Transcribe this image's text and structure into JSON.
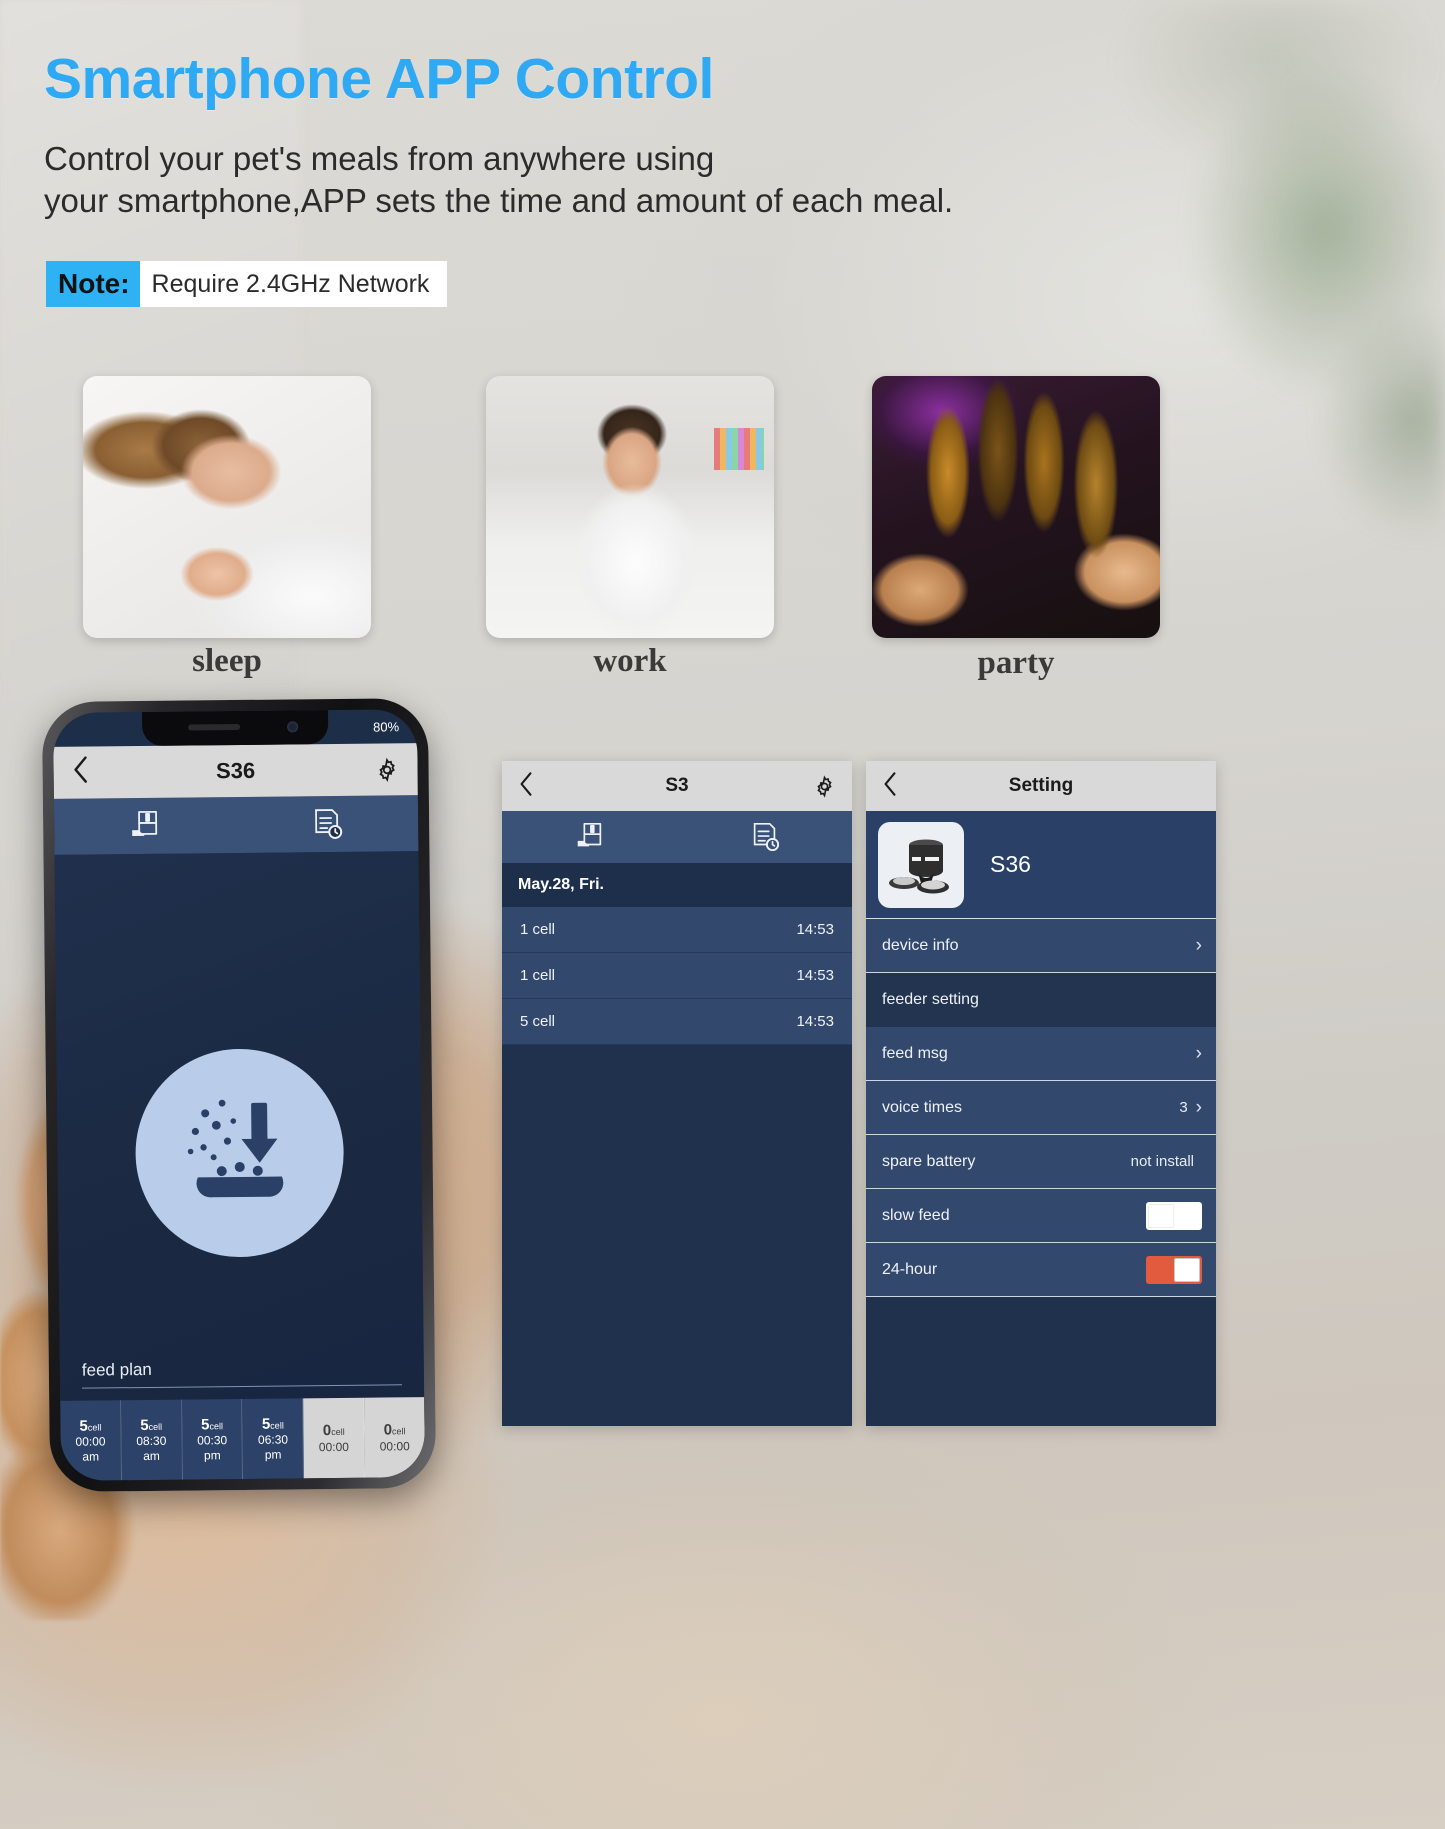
{
  "header": {
    "title": "Smartphone APP Control",
    "subtitle_line1": "Control your pet's meals from anywhere using",
    "subtitle_line2": "your smartphone,APP sets the time and amount of each meal.",
    "note_tag": "Note:",
    "note_text": "Require 2.4GHz Network",
    "accent_color": "#2fa9f4",
    "note_tag_color": "#2eb2f4"
  },
  "scenes": [
    {
      "caption": "sleep",
      "image_name": "woman-sleeping-photo"
    },
    {
      "caption": "work",
      "image_name": "woman-working-photo"
    },
    {
      "caption": "party",
      "image_name": "people-toasting-bottles-photo"
    }
  ],
  "phone": {
    "status": {
      "battery": "80%"
    },
    "navbar": {
      "back_icon": "chevron-left-icon",
      "title": "S36",
      "gear_icon": "gear-icon"
    },
    "tabs": [
      {
        "icon": "feeder-device-icon"
      },
      {
        "icon": "feed-log-clock-icon"
      }
    ],
    "main": {
      "center_icon": "food-dispense-icon"
    },
    "feed_plan_label": "feed plan",
    "schedule": [
      {
        "amount": "5",
        "unit": "cell",
        "time": "00:00",
        "meridiem": "am",
        "state": "active"
      },
      {
        "amount": "5",
        "unit": "cell",
        "time": "08:30",
        "meridiem": "am",
        "state": "active"
      },
      {
        "amount": "5",
        "unit": "cell",
        "time": "00:30",
        "meridiem": "pm",
        "state": "active"
      },
      {
        "amount": "5",
        "unit": "cell",
        "time": "06:30",
        "meridiem": "pm",
        "state": "active"
      },
      {
        "amount": "0",
        "unit": "cell",
        "time": "00:00",
        "meridiem": "",
        "state": "inactive"
      },
      {
        "amount": "0",
        "unit": "cell",
        "time": "00:00",
        "meridiem": "",
        "state": "inactive"
      }
    ]
  },
  "panel_log": {
    "navbar": {
      "back_icon": "chevron-left-icon",
      "title": "S3",
      "gear_icon": "gear-icon"
    },
    "tabs": [
      {
        "icon": "feeder-device-icon"
      },
      {
        "icon": "feed-log-clock-icon"
      }
    ],
    "date_header": "May.28,  Fri.",
    "rows": [
      {
        "amount": "1 cell",
        "time": "14:53"
      },
      {
        "amount": "1 cell",
        "time": "14:53"
      },
      {
        "amount": "5 cell",
        "time": "14:53"
      }
    ]
  },
  "panel_setting": {
    "navbar": {
      "back_icon": "chevron-left-icon",
      "title": "Setting"
    },
    "device": {
      "thumb_icon": "pet-feeder-product-image",
      "name": "S36"
    },
    "rows": [
      {
        "label": "device info",
        "value": "",
        "control": "chevron",
        "emphasis": false
      },
      {
        "label": "feeder setting",
        "value": "",
        "control": "none",
        "emphasis": true
      },
      {
        "label": "feed msg",
        "value": "",
        "control": "chevron",
        "emphasis": false
      },
      {
        "label": "voice times",
        "value": "3",
        "control": "chevron",
        "emphasis": false
      },
      {
        "label": "spare battery",
        "value": "not install",
        "control": "none",
        "emphasis": false
      },
      {
        "label": "slow feed",
        "value": "",
        "control": "toggle-off",
        "emphasis": false
      },
      {
        "label": "24-hour",
        "value": "",
        "control": "toggle-on",
        "emphasis": false
      }
    ],
    "toggle_on_color": "#e35b3e"
  }
}
